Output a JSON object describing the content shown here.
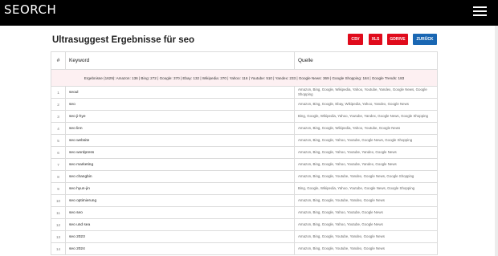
{
  "header": {
    "logo": "SEORCH",
    "menu_icon": "hamburger-menu-icon"
  },
  "page": {
    "title": "Ultrasuggest Ergebnisse für seo",
    "buttons": {
      "csv": "CSV",
      "xls": "XLS",
      "gdrive": "GDRIVE",
      "back": "ZURÜCK"
    }
  },
  "colors": {
    "export_button": "#e00b1c",
    "back_button": "#1a67b3",
    "summary_bg": "#fdf0f2"
  },
  "table": {
    "headers": {
      "num": "#",
      "keyword": "Keyword",
      "source": "Quelle"
    },
    "summary": "Ergebnisse (1629): Amazon: 136 | Bing: 272 | Google: 370 | Ebay: 132 | Wikipedia: 370 | Yahoo: 116 | Youtube: 510 | Yandex: 233 | Google News: 369 | Google Shopping: 184 | Google Trends: 183",
    "rows": [
      {
        "num": "1",
        "keyword": "seoul",
        "source": "Amazon, Bing, Google, Wikipedia, Yahoo, Youtube, Yandex, Google News, Google Shopping"
      },
      {
        "num": "2",
        "keyword": "seo",
        "source": "Amazon, Bing, Google, Ebay, Wikipedia, Yahoo, Yandex, Google News"
      },
      {
        "num": "3",
        "keyword": "seo ji-hye",
        "source": "Bing, Google, Wikipedia, Yahoo, Youtube, Yandex, Google News, Google Shopping"
      },
      {
        "num": "4",
        "keyword": "seo linn",
        "source": "Amazon, Bing, Google, Wikipedia, Yahoo, Youtube, Google News"
      },
      {
        "num": "5",
        "keyword": "seo website",
        "source": "Amazon, Bing, Google, Yahoo, Youtube, Google News, Google Shopping"
      },
      {
        "num": "6",
        "keyword": "seo wordpress",
        "source": "Amazon, Bing, Google, Yahoo, Youtube, Yandex, Google News"
      },
      {
        "num": "7",
        "keyword": "seo marketing",
        "source": "Amazon, Bing, Google, Yahoo, Youtube, Yandex, Google News"
      },
      {
        "num": "8",
        "keyword": "seo changbin",
        "source": "Amazon, Bing, Google, Youtube, Yandex, Google News, Google Shopping"
      },
      {
        "num": "9",
        "keyword": "seo hyun-jin",
        "source": "Bing, Google, Wikipedia, Yahoo, Youtube, Google News, Google Shopping"
      },
      {
        "num": "10",
        "keyword": "seo optimierung",
        "source": "Amazon, Bing, Google, Youtube, Yandex, Google News"
      },
      {
        "num": "11",
        "keyword": "seo seo",
        "source": "Amazon, Bing, Google, Yahoo, Youtube, Google News"
      },
      {
        "num": "12",
        "keyword": "seo und sea",
        "source": "Amazon, Bing, Google, Yahoo, Youtube, Google News"
      },
      {
        "num": "13",
        "keyword": "seo 2023",
        "source": "Amazon, Bing, Google, Youtube, Yandex, Google News"
      },
      {
        "num": "14",
        "keyword": "seo 2024",
        "source": "Amazon, Bing, Google, Youtube, Yandex, Google News"
      }
    ]
  }
}
